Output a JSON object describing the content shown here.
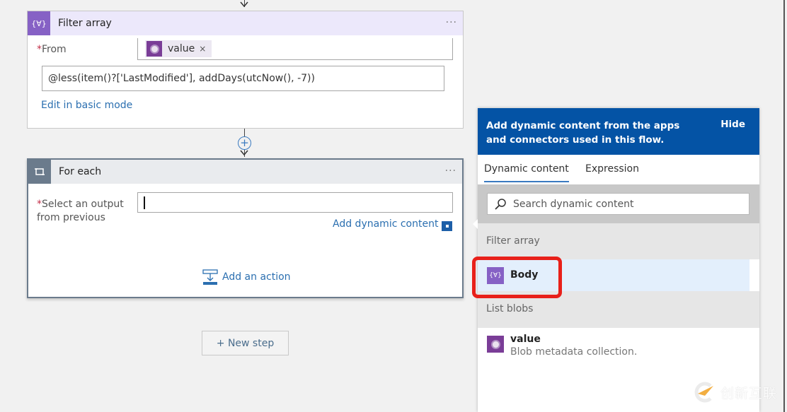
{
  "filter_card": {
    "title": "Filter array",
    "more": "···",
    "from_label": "From",
    "required_marker": "*",
    "from_token": {
      "value": "value",
      "remove": "×"
    },
    "expression": "@less(item()?['LastModified'], addDays(utcNow(), -7))",
    "edit_link": "Edit in basic mode",
    "accent": "#8661c5",
    "header_bg": "#ece8fb"
  },
  "foreach_card": {
    "title": "For each",
    "more": "···",
    "required_marker": "*",
    "select_label_line1": "Select an output",
    "select_label_line2": "from previous",
    "select_value": "",
    "add_dynamic_link": "Add dynamic content",
    "add_action": "Add an action",
    "accent": "#6b7b8c",
    "header_bg": "#e9ebee"
  },
  "new_step": {
    "label": "+ New step"
  },
  "dynamic_panel": {
    "header_text": "Add dynamic content from the apps and connectors used in this flow.",
    "hide_label": "Hide",
    "tabs": [
      {
        "label": "Dynamic content",
        "active": true
      },
      {
        "label": "Expression",
        "active": false
      }
    ],
    "search_placeholder": "Search dynamic content",
    "sections": [
      {
        "title": "Filter array",
        "items": [
          {
            "title": "Body",
            "description": "",
            "selected": true,
            "highlighted": true
          }
        ]
      },
      {
        "title": "List blobs",
        "items": [
          {
            "title": "value",
            "description": "Blob metadata collection."
          }
        ]
      }
    ],
    "header_color": "#0453a5"
  },
  "watermark": {
    "text": "创新互联"
  }
}
